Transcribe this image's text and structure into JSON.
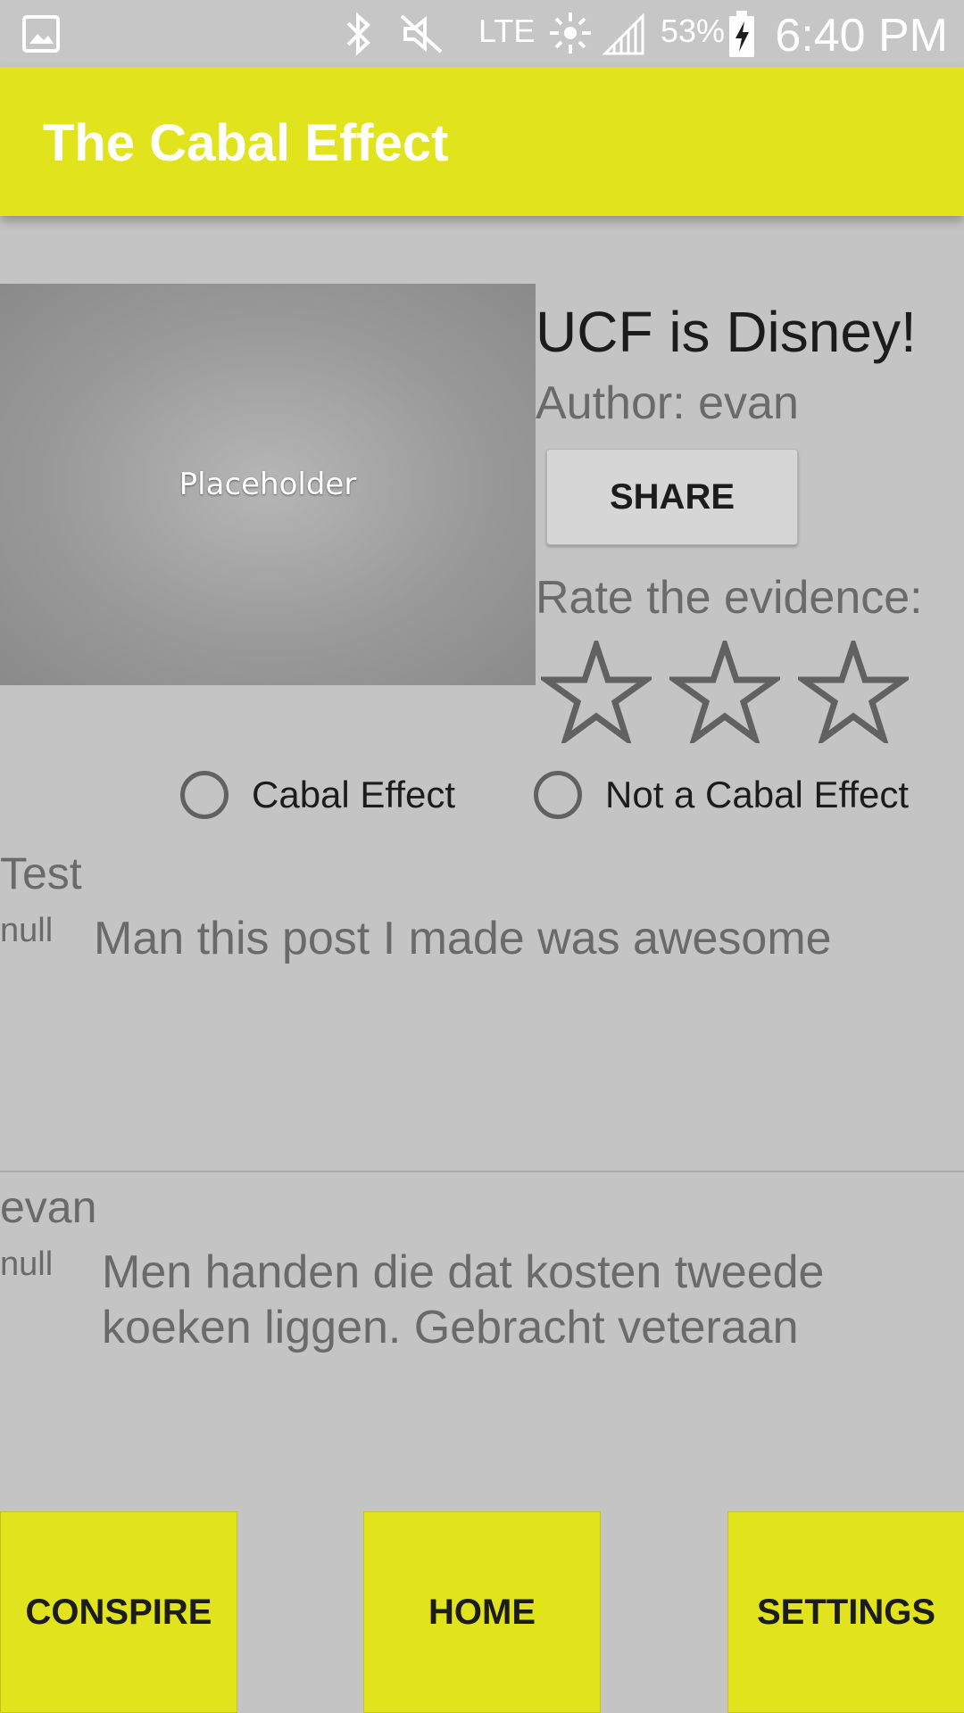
{
  "status_bar": {
    "carrier_label": "LTE",
    "battery": "53%",
    "time": "6:40 PM",
    "icons": [
      "gallery-icon",
      "bluetooth-icon",
      "mute-icon",
      "lte-icon",
      "sync-icon",
      "signal-icon",
      "battery-charging-icon"
    ]
  },
  "app_bar": {
    "title": "The Cabal Effect",
    "color": "#e1e31c"
  },
  "post": {
    "image_placeholder": "Placeholder",
    "title": "UCF is Disney!",
    "author": "Author: evan",
    "share_label": "SHARE",
    "rate_label": "Rate the evidence:",
    "rating": {
      "value": 0,
      "max": 3
    }
  },
  "vote": {
    "options": [
      {
        "label": "Cabal Effect",
        "selected": false
      },
      {
        "label": "Not a Cabal Effect",
        "selected": false
      }
    ]
  },
  "comments": [
    {
      "author": "Test",
      "rating": "null",
      "body": "Man this post I made was awesome"
    },
    {
      "author": "evan",
      "rating": "null",
      "body": "Men handen die dat kosten tweede koeken liggen. Gebracht veteraan"
    }
  ],
  "nav": {
    "conspire": "CONSPIRE",
    "home": "HOME",
    "settings": "SETTINGS"
  }
}
